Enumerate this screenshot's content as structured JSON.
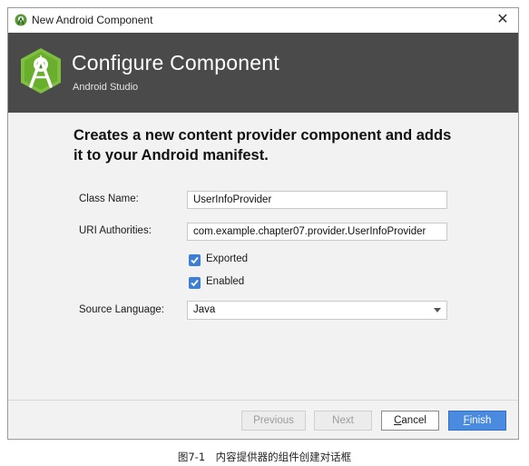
{
  "window": {
    "title": "New Android Component",
    "close_glyph": "✕"
  },
  "banner": {
    "title": "Configure Component",
    "subtitle": "Android Studio",
    "logo_icon": "android-studio-icon",
    "background_color": "#4a4a4a"
  },
  "form": {
    "heading": "Creates a new content provider component and adds it to your Android manifest.",
    "class_name": {
      "label": "Class Name:",
      "value": "UserInfoProvider"
    },
    "uri_authorities": {
      "label": "URI Authorities:",
      "value": "com.example.chapter07.provider.UserInfoProvider"
    },
    "exported": {
      "label": "Exported",
      "checked": true
    },
    "enabled": {
      "label": "Enabled",
      "checked": true
    },
    "source_language": {
      "label": "Source Language:",
      "selected": "Java"
    },
    "checkbox_color": "#3c7fd5"
  },
  "footer": {
    "previous_label": "Previous",
    "next_label": "Next",
    "cancel_prefix": "C",
    "cancel_rest": "ancel",
    "finish_prefix": "F",
    "finish_rest": "inish",
    "primary_color": "#4a8be0"
  },
  "caption": "图7-1　内容提供器的组件创建对话框"
}
